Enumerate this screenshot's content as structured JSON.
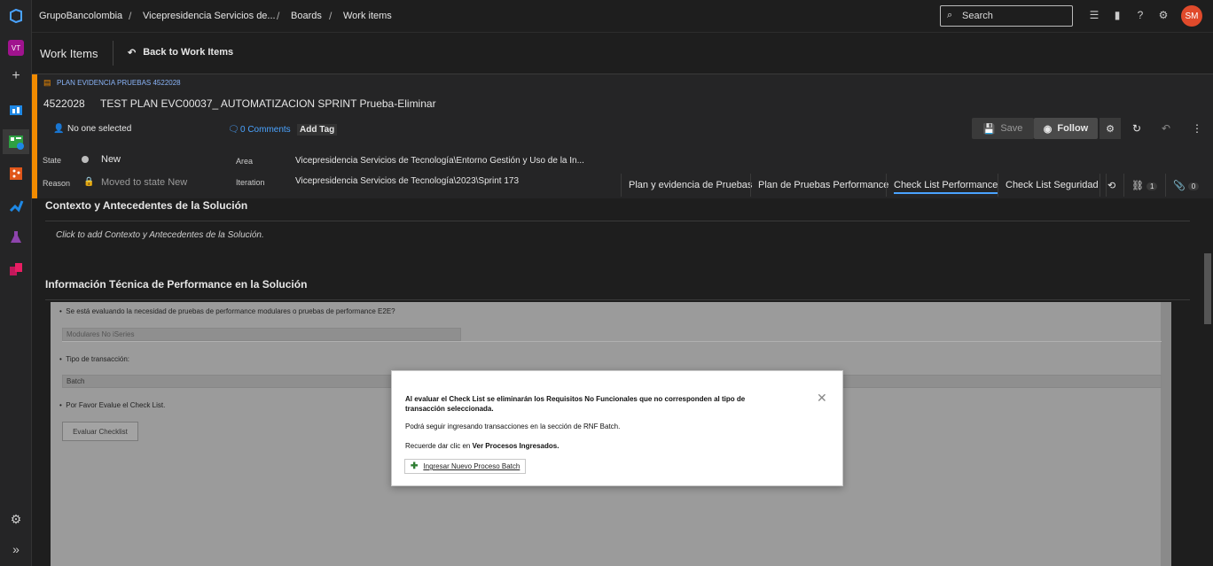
{
  "topbar": {
    "org": "GrupoBancolombia",
    "project": "Vicepresidencia Servicios de...",
    "boards": "Boards",
    "workitems": "Work items",
    "separator": "/",
    "search_placeholder": "Search",
    "avatar_initials": "SM",
    "avatar_color": "#e04a2b"
  },
  "rail": {
    "avatar_initials": "VT",
    "avatar_color": "#a0138e"
  },
  "wihead": {
    "title": "Work Items",
    "back_label": "Back to Work Items"
  },
  "workitem": {
    "type_label": "PLAN EVIDENCIA PRUEBAS 4522028",
    "id": "4522028",
    "title": "TEST PLAN EVC00037_ AUTOMATIZACION SPRINT Prueba-Eliminar",
    "assigned": "No one selected",
    "comments": "0 Comments",
    "add_tag": "Add Tag",
    "save_label": "Save",
    "follow_label": "Follow",
    "accent_color": "#f28b00",
    "fields": {
      "state_label": "State",
      "state_value": "New",
      "reason_label": "Reason",
      "reason_value": "Moved to state New",
      "area_label": "Area",
      "area_value": "Vicepresidencia Servicios de Tecnología\\Entorno Gestión y Uso de la In...",
      "iteration_label": "Iteration",
      "iteration_value": "Vicepresidencia Servicios de Tecnología\\2023\\Sprint 173"
    },
    "tabs": [
      "Plan y evidencia de Pruebas",
      "Plan de Pruebas Performance",
      "Check List Performance",
      "Check List Seguridad"
    ],
    "links_count": "1",
    "attachments_count": "0"
  },
  "content": {
    "section1_title": "Contexto y Antecedentes de la Solución",
    "section1_placeholder": "Click to add Contexto y Antecedentes de la Solución.",
    "section2_title": "Información Técnica de Performance en la Solución",
    "q1": "Se está evaluando la necesidad de pruebas de performance modulares o pruebas de performance E2E?",
    "q1_value": "Modulares No iSeries",
    "q2": "Tipo de transacción:",
    "q2_value": "Batch",
    "q3": "Por Favor Evalue el Check List.",
    "evaluate_button": "Evaluar Checklist"
  },
  "modal": {
    "line1": "Al evaluar el Check List se eliminarán los Requisitos No Funcionales que no corresponden al tipo de transacción seleccionada.",
    "line2": "Podrá seguir ingresando transacciones en la sección de RNF Batch.",
    "line3_prefix": "Recuerde dar clic en",
    "line3_bold": "Ver Procesos Ingresados.",
    "link_label": "Ingresar Nuevo Proceso Batch"
  }
}
